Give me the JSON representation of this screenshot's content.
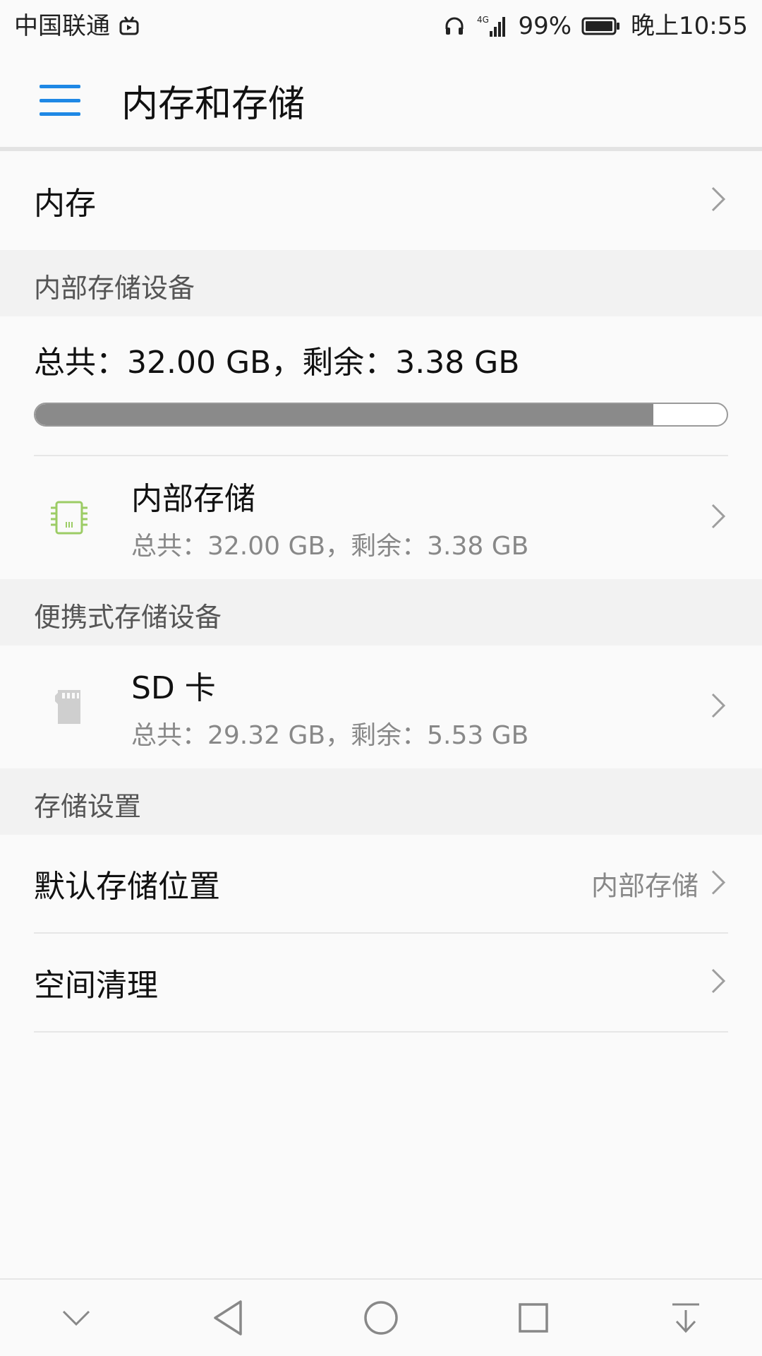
{
  "status_bar": {
    "carrier": "中国联通",
    "network": "4G",
    "battery_percent": "99%",
    "time": "晚上10:55",
    "icons": [
      "tv-icon",
      "headphone-icon",
      "signal-icon",
      "battery-icon"
    ]
  },
  "header": {
    "title": "内存和存储"
  },
  "memory_row": {
    "label": "内存"
  },
  "internal_section": {
    "header": "内部存储设备",
    "total_line": "总共：32.00 GB，剩余：3.38 GB",
    "usage_fraction": 0.894,
    "item": {
      "title": "内部存储",
      "subtitle": "总共：32.00 GB，剩余：3.38 GB",
      "icon": "chip-icon"
    }
  },
  "portable_section": {
    "header": "便携式存储设备",
    "item": {
      "title": "SD 卡",
      "subtitle": "总共：29.32 GB，剩余：5.53 GB",
      "icon": "sd-card-icon"
    }
  },
  "settings_section": {
    "header": "存储设置",
    "default_location": {
      "label": "默认存储位置",
      "value": "内部存储"
    },
    "cleanup": {
      "label": "空间清理"
    }
  },
  "colors": {
    "accent": "#1e88e5",
    "chip_icon": "#9ccc65",
    "progress_fill": "#8a8a8a"
  },
  "nav": [
    "chevron-down-icon",
    "back-icon",
    "home-icon",
    "recents-icon",
    "notification-pull-icon"
  ]
}
